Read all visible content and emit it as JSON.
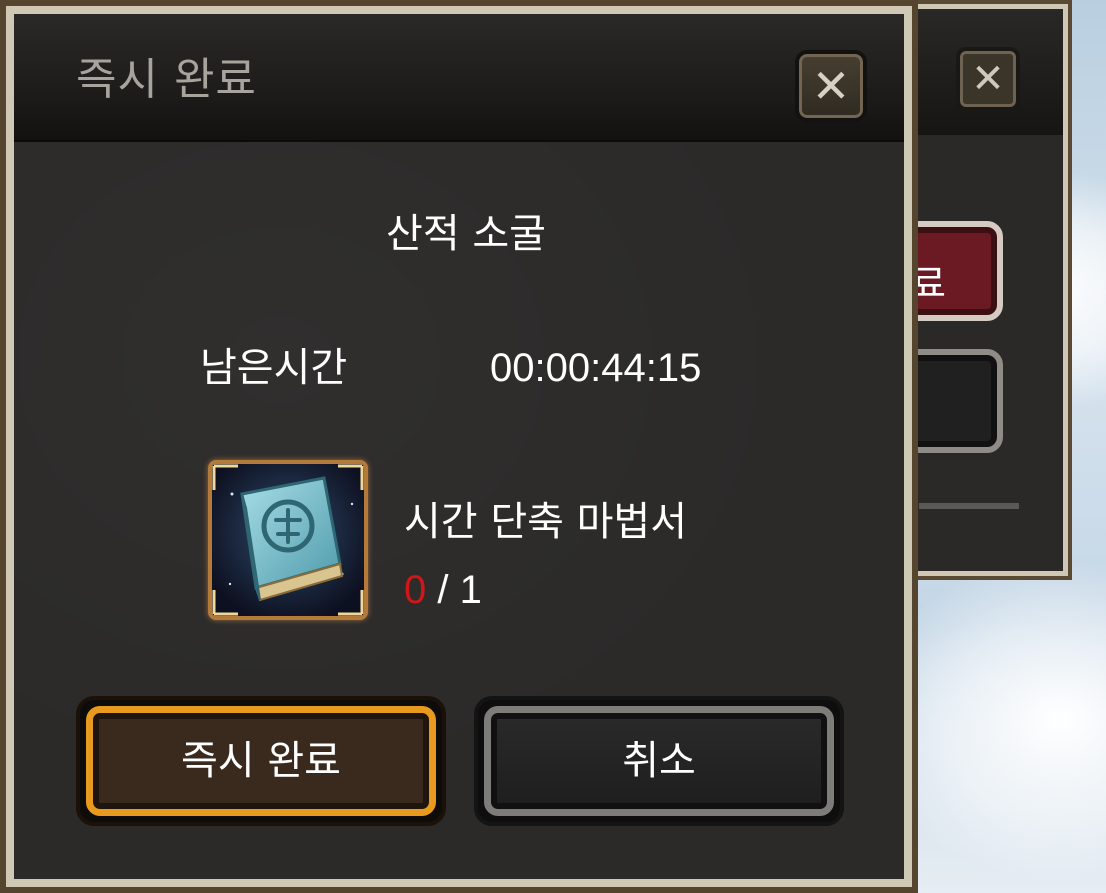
{
  "background_window": {
    "close_symbol": "✕",
    "partial_button_label": "료"
  },
  "dialog": {
    "title": "즉시 완료",
    "close_symbol": "✕",
    "dungeon_name": "산적 소굴",
    "remaining_time_label": "남은시간",
    "remaining_time_value": "00:00:44:15",
    "item": {
      "icon": "spellbook-icon",
      "name": "시간 단축 마법서",
      "have": "0",
      "separator": "/",
      "need": "1"
    },
    "buttons": {
      "confirm_label": "즉시 완료",
      "cancel_label": "취소"
    }
  },
  "colors": {
    "confirm_border": "#e89a1e",
    "insufficient_count": "#d01616",
    "frame": "#cfc8b4"
  }
}
